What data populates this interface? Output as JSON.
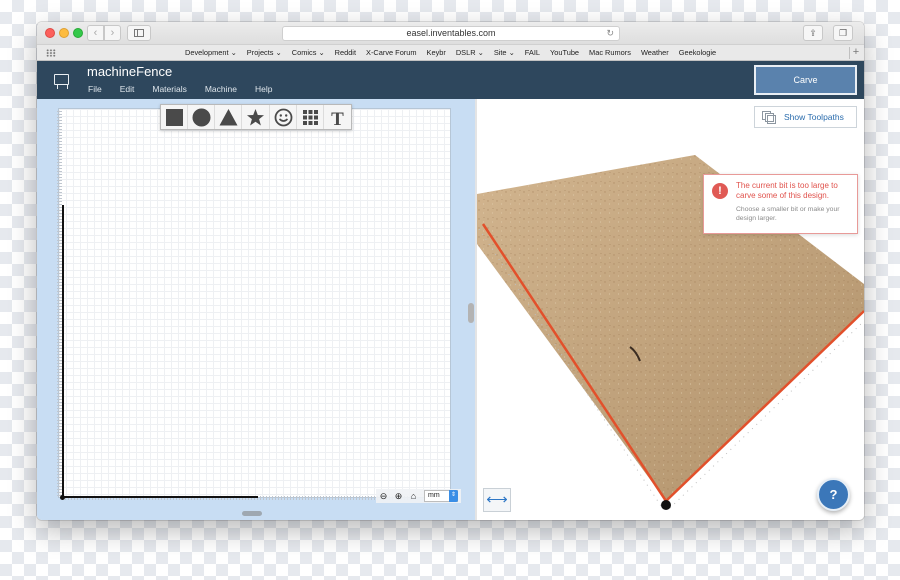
{
  "browser": {
    "url": "easel.inventables.com",
    "back_glyph": "‹",
    "forward_glyph": "›",
    "reload_glyph": "↻",
    "share_glyph": "⇪",
    "tabs_glyph": "❐",
    "add_glyph": "+"
  },
  "bookmarks": [
    {
      "label": "Development ⌄"
    },
    {
      "label": "Projects ⌄"
    },
    {
      "label": "Comics ⌄"
    },
    {
      "label": "Reddit"
    },
    {
      "label": "X-Carve Forum"
    },
    {
      "label": "Keybr"
    },
    {
      "label": "DSLR ⌄"
    },
    {
      "label": "Site ⌄"
    },
    {
      "label": "FAIL"
    },
    {
      "label": "YouTube"
    },
    {
      "label": "Mac Rumors"
    },
    {
      "label": "Weather"
    },
    {
      "label": "Geekologie"
    }
  ],
  "app": {
    "project_name": "machineFence",
    "menu": [
      {
        "label": "File"
      },
      {
        "label": "Edit"
      },
      {
        "label": "Materials"
      },
      {
        "label": "Machine"
      },
      {
        "label": "Help"
      }
    ],
    "carve_label": "Carve",
    "header_color": "#2e475d",
    "accent_color": "#5a82ad"
  },
  "design": {
    "tools": [
      {
        "name": "square-tool-icon"
      },
      {
        "name": "circle-tool-icon"
      },
      {
        "name": "triangle-tool-icon"
      },
      {
        "name": "star-tool-icon"
      },
      {
        "name": "smiley-tool-icon"
      },
      {
        "name": "grid-tool-icon"
      },
      {
        "name": "text-tool-icon"
      }
    ],
    "text_tool_glyph": "T",
    "zoom_out_glyph": "⊖",
    "zoom_in_glyph": "⊕",
    "home_glyph": "⌂",
    "unit": "mm",
    "unit_spinner_glyph": "⇕"
  },
  "preview": {
    "show_toolpaths_label": "Show Toolpaths",
    "warning": {
      "icon_glyph": "!",
      "title": "The current bit is too large to carve some of this design.",
      "subtitle": "Choose a smaller bit or make your design larger.",
      "color": "#e0524c"
    },
    "fit_glyph": "⟷",
    "help_glyph": "?"
  }
}
